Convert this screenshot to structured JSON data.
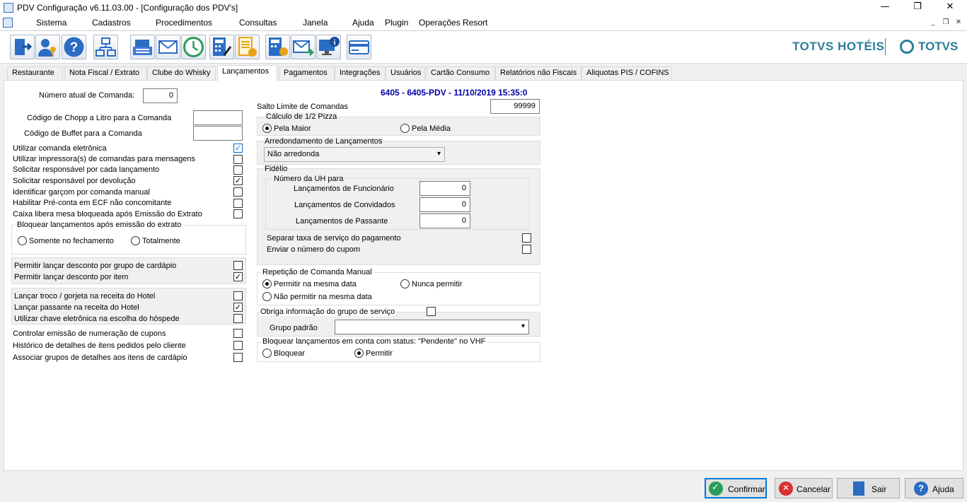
{
  "window": {
    "title": "PDV Configuração v6.11.03.00 - [Configuração dos PDV's]"
  },
  "menu": [
    "Sistema",
    "Cadastros",
    "Procedimentos",
    "Consultas",
    "Janela",
    "Ajuda",
    "Plugin",
    "Operações Resort"
  ],
  "brand": {
    "name": "TOTVS HOTÉIS",
    "logo": "TOTVS",
    "color": "#2a7e9a"
  },
  "tabs": [
    "Restaurante",
    "Nota Fiscal / Extrato",
    "Clube do Whisky",
    "Lançamentos",
    "Pagamentos",
    "Integrações",
    "Usuários",
    "Cartão Consumo",
    "Relatórios não Fiscais",
    "Aliquotas PIS / COFINS"
  ],
  "active_tab": "Lançamentos",
  "header_info": "6405 - 6405-PDV - 11/10/2019 15:35:0",
  "left": {
    "numero_atual_label": "Número atual de Comanda:",
    "numero_atual_value": "0",
    "chopp_label": "Código de Chopp a Litro para a Comanda",
    "chopp_value": "",
    "buffet_label": "Código de Buffet para a Comanda",
    "buffet_value": "",
    "options": [
      {
        "label": "Utilizar comanda eletrônica",
        "checked": true
      },
      {
        "label": "Utilizar impressora(s) de comandas para mensagens",
        "checked": false
      },
      {
        "label": "Solicitar responsável por cada lançamento",
        "checked": false
      },
      {
        "label": "Solicitar responsável por devolução",
        "checked": true
      },
      {
        "label": "Identificar garçom por comanda manual",
        "checked": false
      },
      {
        "label": "Habilitar Pré-conta em ECF não concomitante",
        "checked": false
      },
      {
        "label": "Caixa libera mesa bloqueada após Emissão do Extrato",
        "checked": false
      }
    ],
    "bloquear_group": {
      "title": "Bloquear lançamentos após emissão do extrato",
      "opt1": "Somente no fechamento",
      "opt2": "Totalmente"
    },
    "desconto": [
      {
        "label": "Permitir lançar desconto por grupo de cardápio",
        "checked": false
      },
      {
        "label": "Permitir lançar desconto por item",
        "checked": true
      }
    ],
    "hotel": [
      {
        "label": "Lançar troco / gorjeta na receita do Hotel",
        "checked": false
      },
      {
        "label": "Lançar passante na receita do Hotel",
        "checked": true
      },
      {
        "label": "Utilizar chave eletrônica na escolha do hóspede",
        "checked": false
      }
    ],
    "extra": [
      {
        "label": "Controlar emissão de numeração de cupons",
        "checked": false
      },
      {
        "label": "Histórico de detalhes de itens pedidos pelo cliente",
        "checked": false
      },
      {
        "label": "Associar grupos de detalhes aos itens de cardápio",
        "checked": false
      }
    ]
  },
  "right": {
    "salto_label": "Salto Limite de Comandas",
    "salto_value": "99999",
    "pizza": {
      "title": "Cálculo de 1/2 Pizza",
      "opt1": "Pela Maior",
      "opt2": "Pela Média",
      "selected": 1
    },
    "arred": {
      "title": "Arredondamento de Lançamentos",
      "value": "Não arredonda"
    },
    "fidelio": {
      "title": "Fidélio",
      "uh_title": "Número da UH para",
      "rows": [
        {
          "label": "Lançamentos de Funcionário",
          "value": "0"
        },
        {
          "label": "Lançamentos de Convidados",
          "value": "0"
        },
        {
          "label": "Lançamentos de Passante",
          "value": "0"
        }
      ],
      "separar": "Separar taxa de serviço do pagamento",
      "enviar": "Enviar o número do cupom"
    },
    "repeticao": {
      "title": "Repetição de Comanda Manual",
      "opt1": "Permitir na mesma data",
      "opt2": "Nunca permitir",
      "opt3": "Não permitir na mesma data",
      "selected": 1
    },
    "obriga": {
      "title": "Obriga informação do grupo de serviço",
      "grupo_label": "Grupo padrão",
      "grupo_value": ""
    },
    "pendente": {
      "title": "Bloquear lançamentos em conta com status: \"Pendente\" no VHF",
      "opt1": "Bloquear",
      "opt2": "Permitir",
      "selected": 2
    }
  },
  "buttons": {
    "confirmar": "Confirmar",
    "cancelar": "Cancelar",
    "sair": "Sair",
    "ajuda": "Ajuda"
  }
}
